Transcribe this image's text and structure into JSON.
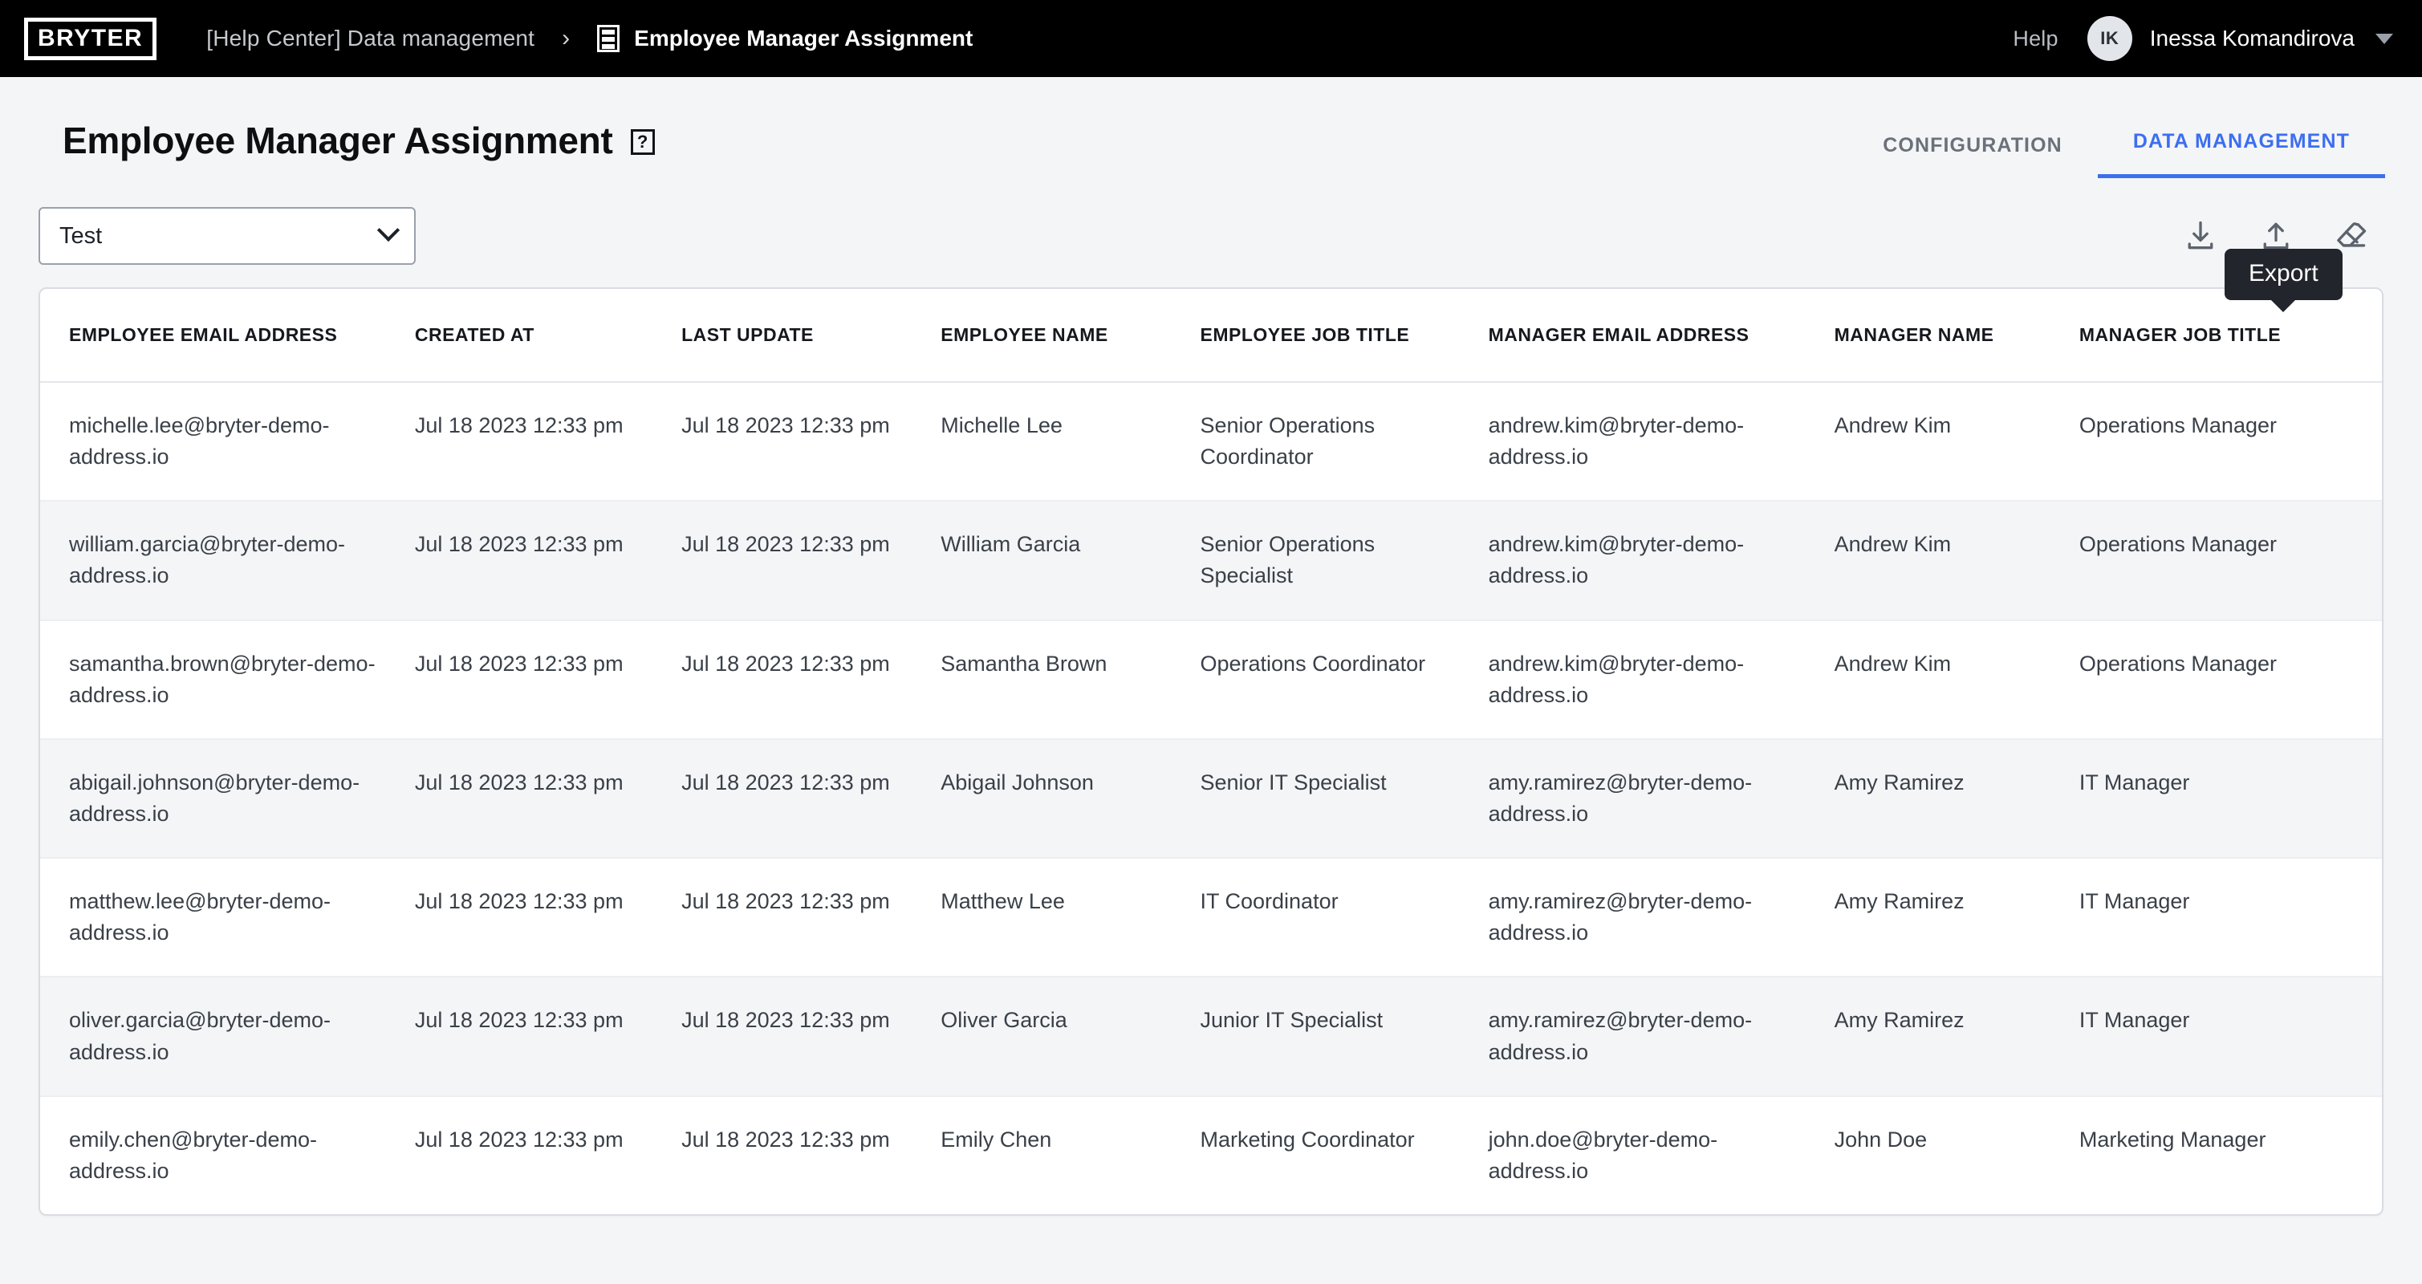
{
  "topbar": {
    "logo": "BRYTER",
    "breadcrumb_parent": "[Help Center] Data management",
    "breadcrumb_separator": "›",
    "breadcrumb_current": "Employee Manager Assignment",
    "help_label": "Help",
    "avatar_initials": "IK",
    "user_name": "Inessa Komandirova"
  },
  "page": {
    "title": "Employee Manager Assignment",
    "help_icon_label": "?",
    "tabs": [
      {
        "label": "CONFIGURATION",
        "active": false
      },
      {
        "label": "DATA MANAGEMENT",
        "active": true
      }
    ],
    "accent_color": "#3c6ef0"
  },
  "tooltip": {
    "text": "Export"
  },
  "toolbar": {
    "select_value": "Test",
    "actions": [
      {
        "name": "import-icon",
        "label": "Import"
      },
      {
        "name": "export-icon",
        "label": "Export"
      },
      {
        "name": "clear-icon",
        "label": "Clear"
      }
    ]
  },
  "table": {
    "columns": [
      "EMPLOYEE EMAIL ADDRESS",
      "CREATED AT",
      "LAST UPDATE",
      "EMPLOYEE NAME",
      "EMPLOYEE JOB TITLE",
      "MANAGER EMAIL ADDRESS",
      "MANAGER NAME",
      "MANAGER JOB TITLE"
    ],
    "rows": [
      {
        "employee_email": "michelle.lee@bryter-demo-address.io",
        "created_at": "Jul 18 2023 12:33 pm",
        "last_update": "Jul 18 2023 12:33 pm",
        "employee_name": "Michelle Lee",
        "employee_job_title": "Senior Operations Coordinator",
        "manager_email": "andrew.kim@bryter-demo-address.io",
        "manager_name": "Andrew Kim",
        "manager_job_title": "Operations Manager"
      },
      {
        "employee_email": "william.garcia@bryter-demo-address.io",
        "created_at": "Jul 18 2023 12:33 pm",
        "last_update": "Jul 18 2023 12:33 pm",
        "employee_name": "William Garcia",
        "employee_job_title": "Senior Operations Specialist",
        "manager_email": "andrew.kim@bryter-demo-address.io",
        "manager_name": "Andrew Kim",
        "manager_job_title": "Operations Manager"
      },
      {
        "employee_email": "samantha.brown@bryter-demo-address.io",
        "created_at": "Jul 18 2023 12:33 pm",
        "last_update": "Jul 18 2023 12:33 pm",
        "employee_name": "Samantha Brown",
        "employee_job_title": "Operations Coordinator",
        "manager_email": "andrew.kim@bryter-demo-address.io",
        "manager_name": "Andrew Kim",
        "manager_job_title": "Operations Manager"
      },
      {
        "employee_email": "abigail.johnson@bryter-demo-address.io",
        "created_at": "Jul 18 2023 12:33 pm",
        "last_update": "Jul 18 2023 12:33 pm",
        "employee_name": "Abigail Johnson",
        "employee_job_title": "Senior IT Specialist",
        "manager_email": "amy.ramirez@bryter-demo-address.io",
        "manager_name": "Amy Ramirez",
        "manager_job_title": "IT Manager"
      },
      {
        "employee_email": "matthew.lee@bryter-demo-address.io",
        "created_at": "Jul 18 2023 12:33 pm",
        "last_update": "Jul 18 2023 12:33 pm",
        "employee_name": "Matthew Lee",
        "employee_job_title": "IT Coordinator",
        "manager_email": "amy.ramirez@bryter-demo-address.io",
        "manager_name": "Amy Ramirez",
        "manager_job_title": "IT Manager"
      },
      {
        "employee_email": "oliver.garcia@bryter-demo-address.io",
        "created_at": "Jul 18 2023 12:33 pm",
        "last_update": "Jul 18 2023 12:33 pm",
        "employee_name": "Oliver Garcia",
        "employee_job_title": "Junior IT Specialist",
        "manager_email": "amy.ramirez@bryter-demo-address.io",
        "manager_name": "Amy Ramirez",
        "manager_job_title": "IT Manager"
      },
      {
        "employee_email": "emily.chen@bryter-demo-address.io",
        "created_at": "Jul 18 2023 12:33 pm",
        "last_update": "Jul 18 2023 12:33 pm",
        "employee_name": "Emily Chen",
        "employee_job_title": "Marketing Coordinator",
        "manager_email": "john.doe@bryter-demo-address.io",
        "manager_name": "John Doe",
        "manager_job_title": "Marketing Manager"
      }
    ]
  }
}
